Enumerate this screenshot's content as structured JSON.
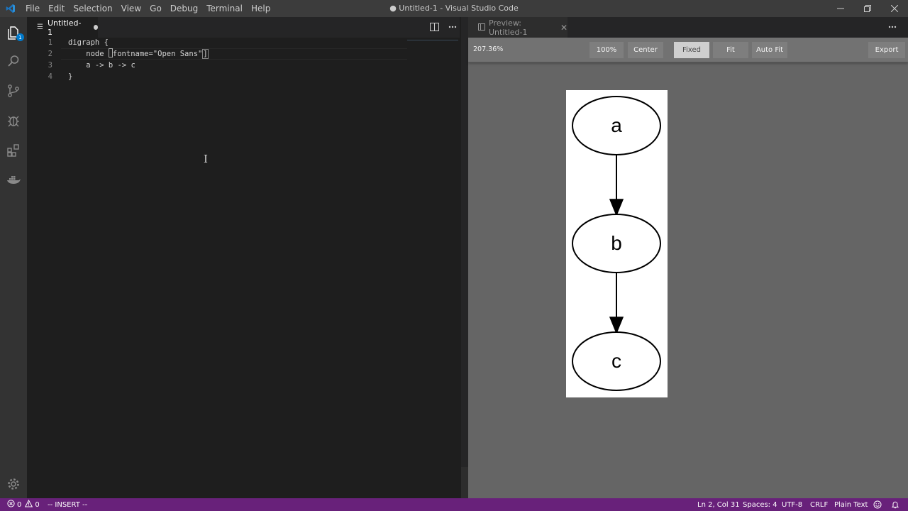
{
  "window": {
    "title": "● Untitled-1 - Visual Studio Code"
  },
  "menu": [
    "File",
    "Edit",
    "Selection",
    "View",
    "Go",
    "Debug",
    "Terminal",
    "Help"
  ],
  "activity_bar": {
    "explorer_badge": "1",
    "items": [
      "explorer-icon",
      "search-icon",
      "source-control-icon",
      "debug-icon",
      "extensions-icon",
      "docker-icon"
    ],
    "bottom": "gear-icon"
  },
  "editor": {
    "tab_label": "Untitled-1",
    "line_numbers": [
      "1",
      "2",
      "3",
      "4"
    ],
    "lines": {
      "l1": "digraph {",
      "l2_a": "    node ",
      "l2_b": "[",
      "l2_c": "fontname=\"Open Sans\"",
      "l2_d": "]",
      "l3": "    a -> b -> c",
      "l4": "}"
    }
  },
  "preview": {
    "tab_label": "Preview: Untitled-1",
    "zoom": "207.36%",
    "buttons": {
      "zoom100": "100%",
      "center": "Center",
      "fixed": "Fixed",
      "fit": "Fit",
      "autofit": "Auto Fit",
      "export": "Export"
    },
    "graph": {
      "nodes": [
        "a",
        "b",
        "c"
      ],
      "edges": [
        [
          "a",
          "b"
        ],
        [
          "b",
          "c"
        ]
      ]
    }
  },
  "statusbar": {
    "errors": "0",
    "warnings": "0",
    "mode": "-- INSERT --",
    "position": "Ln 2, Col 31",
    "spaces": "Spaces: 4",
    "encoding": "UTF-8",
    "eol": "CRLF",
    "language": "Plain Text"
  },
  "colors": {
    "statusbar_bg": "#68217a",
    "editor_bg": "#1e1e1e",
    "activitybar_bg": "#333333",
    "titlebar_bg": "#3c3c3c",
    "preview_bg": "#656565",
    "vscode_blue": "#007acc"
  }
}
